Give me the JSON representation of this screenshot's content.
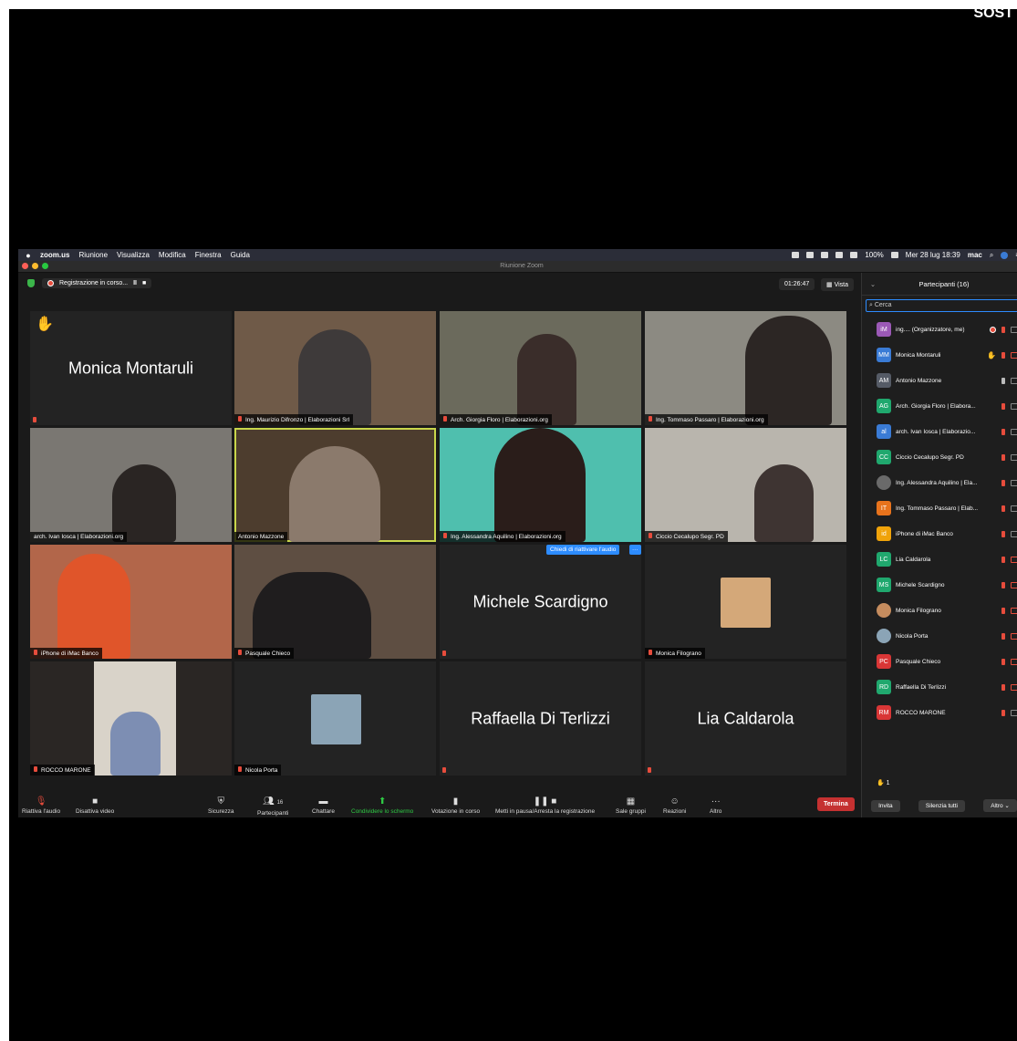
{
  "corner_text": "SOST",
  "menubar": {
    "app": "zoom.us",
    "items": [
      "Riunione",
      "Visualizza",
      "Modifica",
      "Finestra",
      "Guida"
    ],
    "battery": "100%",
    "clock": "Mer 28 lug 18:39",
    "user": "mac"
  },
  "window_title": "Riunione Zoom",
  "recording": {
    "label": "Registrazione in corso...",
    "pause": "II",
    "stop": "■"
  },
  "timer": "01:26:47",
  "view_label": "Vista",
  "tiles": [
    {
      "name": "Monica Montaruli",
      "label": "",
      "type": "name",
      "hand": true
    },
    {
      "name": "",
      "label": "Ing. Maurizio Difronzo | Elaborazioni Srl",
      "type": "video",
      "color": "#6f5a48"
    },
    {
      "name": "",
      "label": "Arch. Giorgia Floro | Elaborazioni.org",
      "type": "video",
      "color": "#6b6a5c"
    },
    {
      "name": "",
      "label": "Ing. Tommaso Passaro | Elaborazioni.org",
      "type": "video",
      "color": "#8c8a82"
    },
    {
      "name": "",
      "label": "arch. Ivan Iosca | Elaborazioni.org",
      "type": "video",
      "color": "#7a7772"
    },
    {
      "name": "",
      "label": "Antonio Mazzone",
      "type": "video",
      "color": "#4d3d2e",
      "active": true
    },
    {
      "name": "",
      "label": "Ing. Alessandra Aquilino | Elaborazioni.org",
      "type": "video",
      "color": "#4fbfae"
    },
    {
      "name": "",
      "label": "Ciccio Cecalupo Segr. PD",
      "type": "video",
      "color": "#b9b5ad"
    },
    {
      "name": "",
      "label": "iPhone di iMac Banco",
      "type": "video",
      "color": "#b2664a"
    },
    {
      "name": "",
      "label": "Pasquale Chieco",
      "type": "video",
      "color": "#5e4e42"
    },
    {
      "name": "Michele Scardigno",
      "label": "",
      "type": "name",
      "unmute": true
    },
    {
      "name": "",
      "label": "Monica Filograno",
      "type": "thumb",
      "color": "#d4a879"
    },
    {
      "name": "",
      "label": "ROCCO MARONE",
      "type": "video",
      "color": "#8a6e58"
    },
    {
      "name": "",
      "label": "Nicola Porta",
      "type": "thumb",
      "color": "#8ba4b6"
    },
    {
      "name": "Raffaella Di Terlizzi",
      "label": "",
      "type": "name"
    },
    {
      "name": "Lia Caldarola",
      "label": "",
      "type": "name"
    }
  ],
  "unmute_request": "Chiedi di riattivare l'audio",
  "unmute_more": "···",
  "toolbar": {
    "unmute": "Riattiva l'audio",
    "video": "Disattiva video",
    "security": "Sicurezza",
    "participants": "Partecipanti",
    "participants_count": "16",
    "chat": "Chattare",
    "share": "Condividere lo schermo",
    "poll": "Votazione in corso",
    "pause_rec": "Metti in pausa/Arresta la registrazione",
    "breakout": "Sale gruppi",
    "reactions": "Reazioni",
    "more": "Altro",
    "end": "Termina"
  },
  "panel": {
    "title": "Partecipanti (16)",
    "search_placeholder": "Cerca",
    "raise_count": "1",
    "invite": "Invita",
    "mute_all": "Silenzia tutti",
    "more": "Altro",
    "participants": [
      {
        "initials": "iM",
        "name": "ing....  (Organizzatore, me)",
        "color": "#9b59b6",
        "mic": "muted",
        "cam": "on",
        "rec": true
      },
      {
        "initials": "MM",
        "name": "Monica Montaruli",
        "color": "#3a7bd5",
        "mic": "muted",
        "cam": "off",
        "hand": true
      },
      {
        "initials": "AM",
        "name": "Antonio Mazzone",
        "color": "#555b66",
        "mic": "on",
        "cam": "on"
      },
      {
        "initials": "AG",
        "name": "Arch. Giorgia Floro | Elabora...",
        "color": "#20a86e",
        "mic": "muted",
        "cam": "on"
      },
      {
        "initials": "al",
        "name": "arch. Ivan Iosca | Elaborazio...",
        "color": "#3a7bd5",
        "mic": "muted",
        "cam": "on"
      },
      {
        "initials": "CC",
        "name": "Ciccio Cecalupo Segr. PD",
        "color": "#20a86e",
        "mic": "muted",
        "cam": "on"
      },
      {
        "initials": "",
        "name": "Ing. Alessandra Aquilino | Ela...",
        "color": "#6a6a6a",
        "mic": "muted",
        "cam": "on",
        "photo": true
      },
      {
        "initials": "IT",
        "name": "Ing. Tommaso Passaro | Elab...",
        "color": "#e8731c",
        "mic": "muted",
        "cam": "on"
      },
      {
        "initials": "id",
        "name": "iPhone di iMac Banco",
        "color": "#f0a30a",
        "mic": "muted",
        "cam": "on"
      },
      {
        "initials": "LC",
        "name": "Lia Caldarola",
        "color": "#20a86e",
        "mic": "muted",
        "cam": "off"
      },
      {
        "initials": "MS",
        "name": "Michele Scardigno",
        "color": "#20a86e",
        "mic": "muted",
        "cam": "off"
      },
      {
        "initials": "",
        "name": "Monica Filograno",
        "color": "#c58c5e",
        "mic": "muted",
        "cam": "off",
        "photo": true
      },
      {
        "initials": "",
        "name": "Nicola Porta",
        "color": "#8ba4b6",
        "mic": "muted",
        "cam": "off",
        "photo": true
      },
      {
        "initials": "PC",
        "name": "Pasquale Chieco",
        "color": "#d93636",
        "mic": "muted",
        "cam": "off"
      },
      {
        "initials": "RD",
        "name": "Raffaella Di Terlizzi",
        "color": "#20a86e",
        "mic": "muted",
        "cam": "off"
      },
      {
        "initials": "RM",
        "name": "ROCCO MARONE",
        "color": "#d93636",
        "mic": "muted",
        "cam": "on"
      }
    ]
  }
}
